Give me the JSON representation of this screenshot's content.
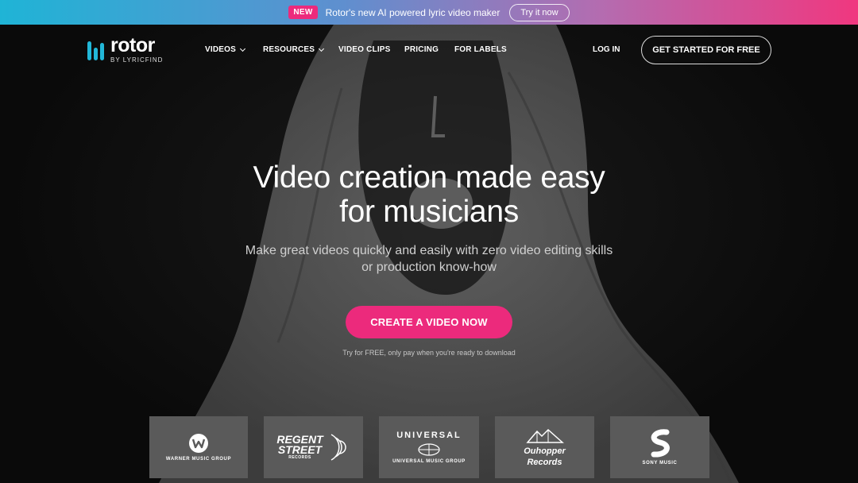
{
  "announcement": {
    "badge": "NEW",
    "text": "Rotor's new AI powered lyric video maker",
    "button": "Try it now"
  },
  "brand": {
    "name": "rotor",
    "tagline": "BY LYRICFIND",
    "accent_color": "#22b7d8",
    "cta_color": "#ec2a7c"
  },
  "nav": {
    "items": [
      {
        "label": "VIDEOS",
        "icon": "chevron-down-icon"
      },
      {
        "label": "RESOURCES",
        "icon": "chevron-down-icon"
      },
      {
        "label": "VIDEO CLIPS"
      },
      {
        "label": "PRICING"
      },
      {
        "label": "FOR LABELS"
      }
    ],
    "login": "LOG IN",
    "cta": "GET STARTED FOR FREE"
  },
  "hero": {
    "headline_line1": "Video creation made easy",
    "headline_line2": "for musicians",
    "subline_line1": "Make great videos quickly and easily with zero video editing skills",
    "subline_line2": "or production know-how",
    "cta": "CREATE A VIDEO NOW",
    "note": "Try for FREE, only pay when you're ready to download"
  },
  "labels": {
    "warner": "WARNER MUSIC GROUP",
    "regent_line1": "REGENT",
    "regent_line2": "STREET",
    "regent_line3": "RECORDS",
    "universal_word": "UNIVERSAL",
    "universal_group": "UNIVERSAL MUSIC GROUP",
    "ouhopper_line1": "Ouhopper",
    "ouhopper_line2": "Records",
    "sony": "SONY MUSIC"
  }
}
